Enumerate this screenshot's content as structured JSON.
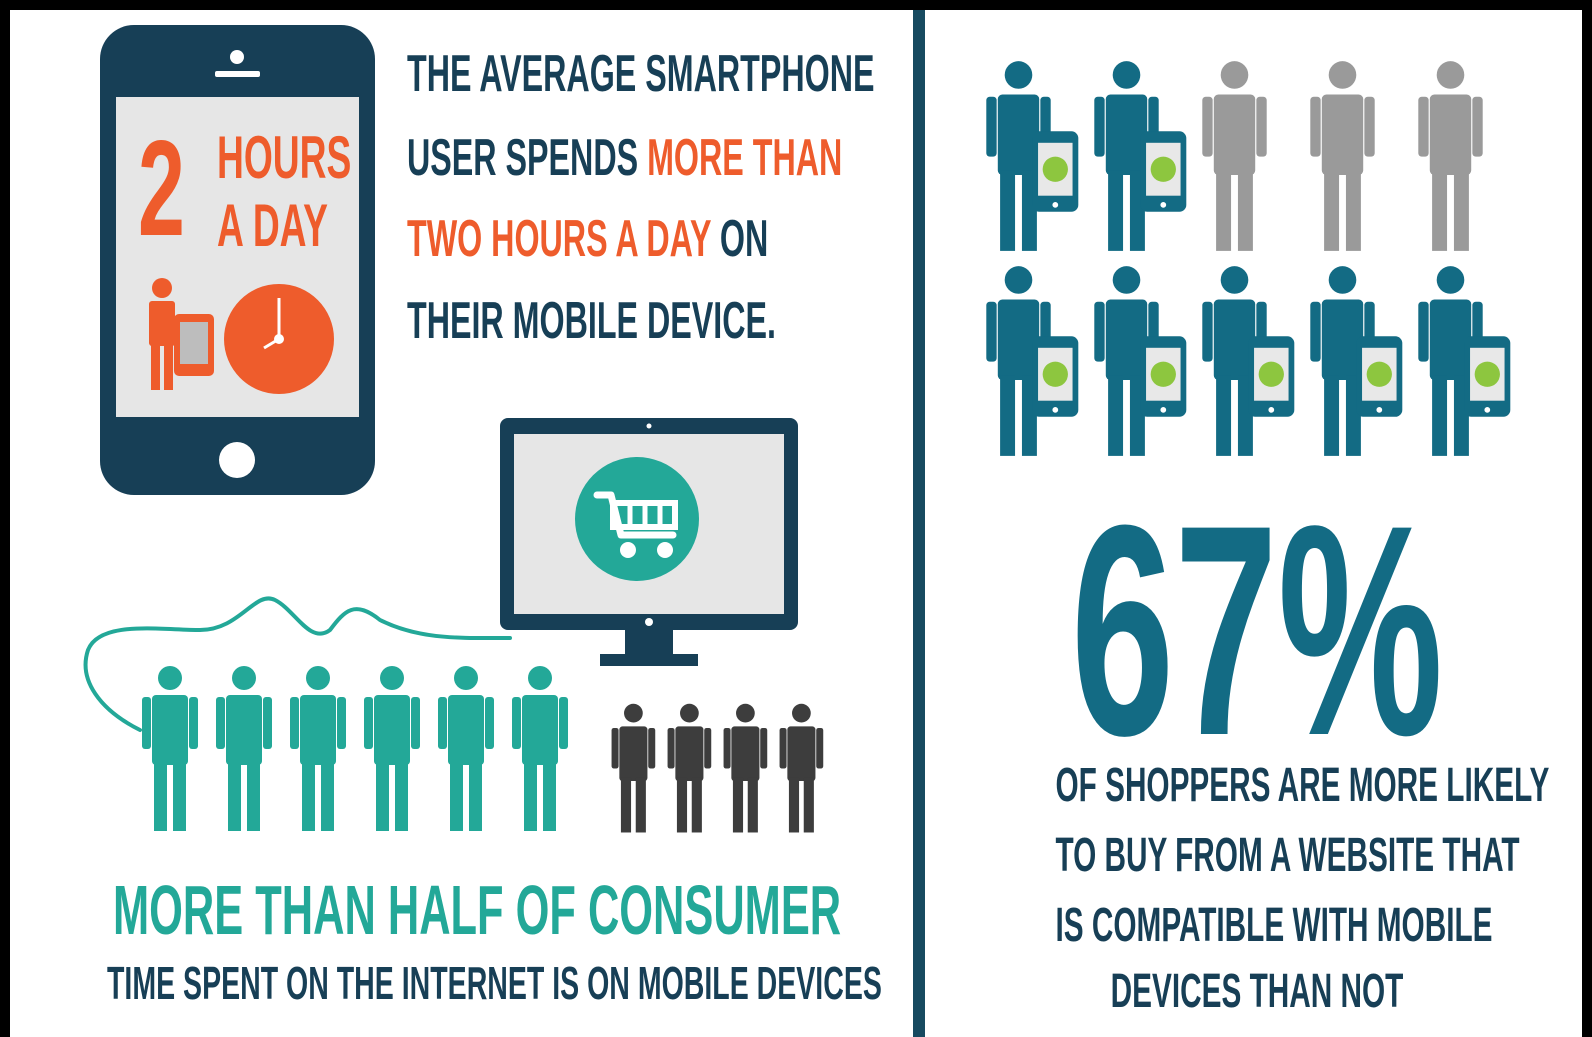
{
  "colors": {
    "navy": "#173f56",
    "orange": "#ee5c2c",
    "teal": "#23a898",
    "petrol": "#136b84",
    "gray": "#9a9a9a",
    "charcoal": "#3d3d3d",
    "cart_green": "#8dc63f"
  },
  "left": {
    "phone": {
      "number": "2",
      "unit_line1": "HOURS",
      "unit_line2": "A DAY",
      "icons": [
        "person-with-tablet-icon",
        "clock-icon"
      ]
    },
    "stat1": {
      "line1": "THE AVERAGE SMARTPHONE",
      "line2_a": "USER SPENDS ",
      "line2_b": "MORE THAN",
      "line3_a": "TWO HOURS A DAY",
      "line3_b": " ON",
      "line4": "THEIR MOBILE DEVICE."
    },
    "monitor": {
      "icon": "shopping-cart-icon"
    },
    "people": {
      "highlighted": 6,
      "total": 10
    },
    "headline": "MORE THAN HALF OF CONSUMER",
    "subline": "TIME SPENT ON THE INTERNET IS ON MOBILE DEVICES"
  },
  "right": {
    "people_grid": {
      "highlighted": 7,
      "total": 10
    },
    "percent": "67%",
    "caption_line1": "OF SHOPPERS ARE MORE LIKELY",
    "caption_line2": "TO BUY FROM A WEBSITE THAT",
    "caption_line3": "IS COMPATIBLE WITH MOBILE",
    "caption_line4": "DEVICES THAN NOT"
  }
}
